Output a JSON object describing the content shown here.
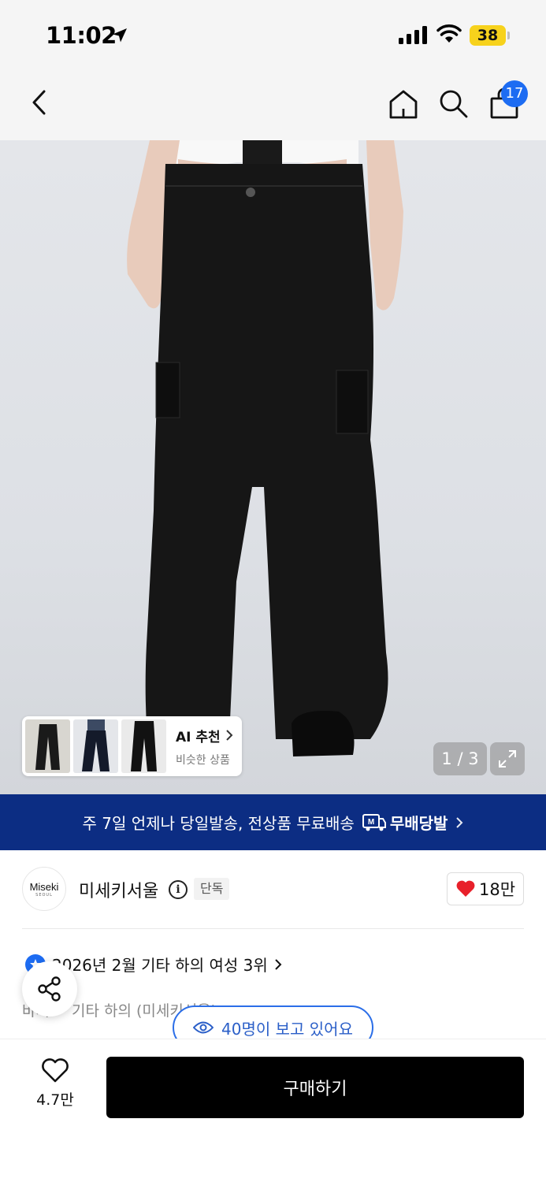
{
  "status_bar": {
    "time": "11:02",
    "battery": "38"
  },
  "nav": {
    "cart_count": "17"
  },
  "gallery": {
    "page_indicator": "1 / 3",
    "ai_card": {
      "title": "AI 추천",
      "subtitle": "비슷한 상품"
    }
  },
  "shipping_banner": {
    "text": "주 7일 언제나 당일발송, 전상품 무료배송",
    "brand": "무배당발",
    "brand_mark": "M"
  },
  "store": {
    "logo_text": "Miseki",
    "logo_sub": "SEOUL",
    "name": "미세키서울",
    "info_symbol": "i",
    "badge": "단독",
    "likes": "18만"
  },
  "ranking": {
    "text": "2026년 2월 기타 하의 여성 3위"
  },
  "category": {
    "text": "바지 > 기타 하의 (미세키서울)"
  },
  "viewers": {
    "text": "40명이 보고 있어요"
  },
  "bottom_bar": {
    "wish_count": "4.7만",
    "buy_label": "구매하기"
  },
  "colors": {
    "accent_blue": "#1d6cf2",
    "banner_navy": "#0c2d83",
    "heart_red": "#e8202a"
  }
}
